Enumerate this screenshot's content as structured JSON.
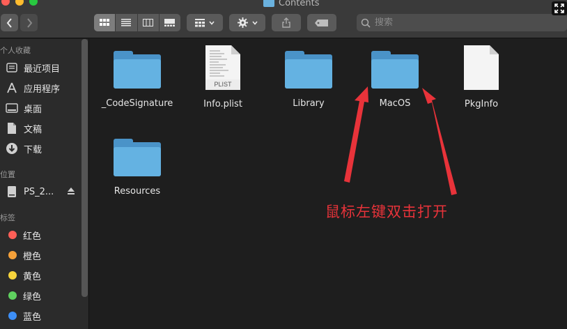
{
  "window": {
    "title": "Contents"
  },
  "toolbar": {
    "search_placeholder": "搜索",
    "back_icon": "chevron-left-icon",
    "forward_icon": "chevron-right-icon"
  },
  "sidebar": {
    "favorites_heading": "个人收藏",
    "favorites": [
      {
        "label": "最近项目",
        "icon": "clock-icon"
      },
      {
        "label": "应用程序",
        "icon": "applications-icon"
      },
      {
        "label": "桌面",
        "icon": "desktop-icon"
      },
      {
        "label": "文稿",
        "icon": "documents-icon"
      },
      {
        "label": "下载",
        "icon": "download-icon"
      }
    ],
    "locations_heading": "位置",
    "locations": [
      {
        "label": "PS_2...",
        "icon": "drive-icon"
      }
    ],
    "tags_heading": "标签",
    "tags": [
      {
        "label": "红色",
        "color": "#fe5f57"
      },
      {
        "label": "橙色",
        "color": "#f5a13a"
      },
      {
        "label": "黄色",
        "color": "#f6d33c"
      },
      {
        "label": "绿色",
        "color": "#5fd15f"
      },
      {
        "label": "蓝色",
        "color": "#3d8ff7"
      }
    ]
  },
  "files": [
    {
      "name": "_CodeSignature",
      "type": "folder"
    },
    {
      "name": "Info.plist",
      "type": "plist",
      "badge": "PLIST"
    },
    {
      "name": "Library",
      "type": "folder"
    },
    {
      "name": "MacOS",
      "type": "folder"
    },
    {
      "name": "PkgInfo",
      "type": "document"
    },
    {
      "name": "Resources",
      "type": "folder"
    }
  ],
  "annotation": {
    "text": "鼠标左键双击打开",
    "color": "#e8333a"
  }
}
